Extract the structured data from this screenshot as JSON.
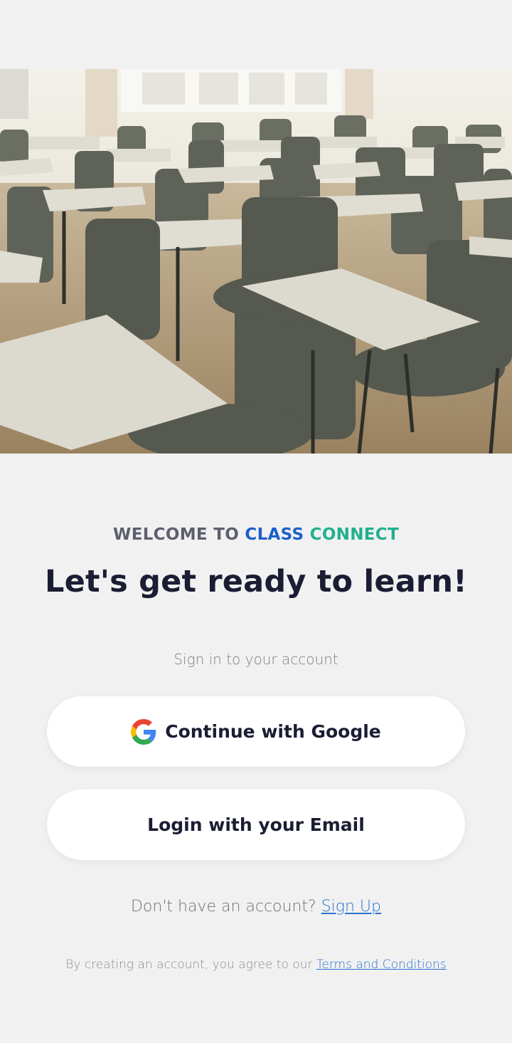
{
  "hero": {
    "image_icon": "classroom-photo"
  },
  "welcome": {
    "prefix": "WELCOME TO",
    "brand_part1": "CLASS",
    "brand_part2": "CONNECT"
  },
  "headline": "Let's get ready to learn!",
  "subtitle": "Sign in to your account",
  "buttons": {
    "google": {
      "label": "Continue with Google",
      "icon": "google-icon"
    },
    "email": {
      "label": "Login with your Email"
    }
  },
  "signup": {
    "prompt": "Don't have an account?",
    "link_label": "Sign Up"
  },
  "terms": {
    "prompt": "By creating an account, you agree to our",
    "link_label": "Terms and Conditions"
  },
  "colors": {
    "background": "#f1f1f1",
    "brand_blue": "#1d5fc9",
    "brand_green": "#21b08e",
    "link": "#2a73cf",
    "text_dark": "#1b1d33"
  }
}
